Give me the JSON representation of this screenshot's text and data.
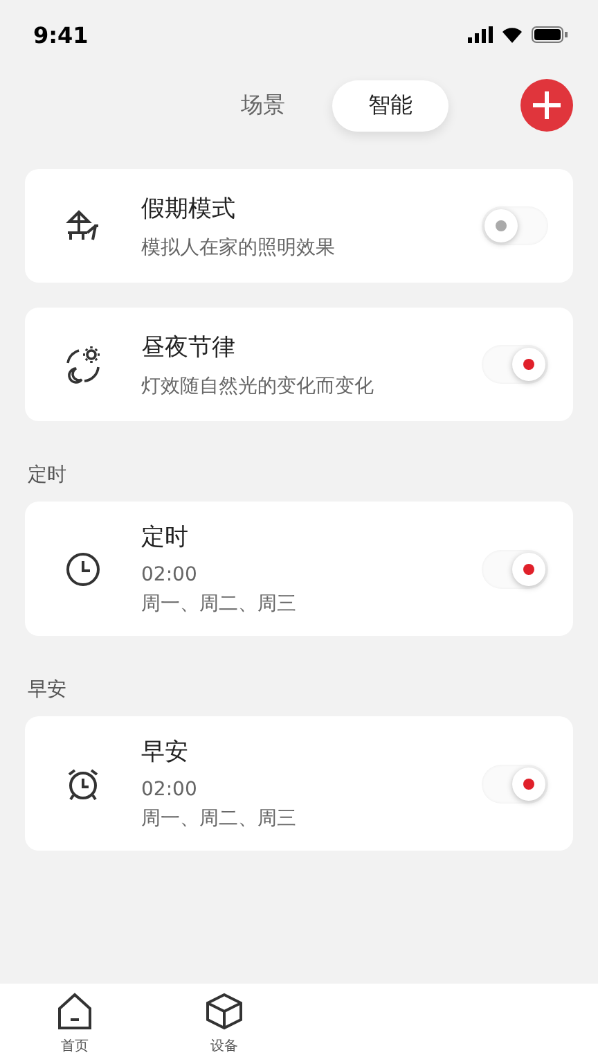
{
  "status_bar": {
    "time": "9:41"
  },
  "segments": [
    {
      "label": "场景",
      "selected": false
    },
    {
      "label": "智能",
      "selected": true
    }
  ],
  "sections": [
    {
      "cards": [
        {
          "kind": "umbrella",
          "title": "假期模式",
          "lines": [
            "模拟人在家的照明效果"
          ],
          "on": false
        },
        {
          "kind": "daynight",
          "title": "昼夜节律",
          "lines": [
            "灯效随自然光的变化而变化"
          ],
          "on": true
        }
      ]
    },
    {
      "heading": "定时",
      "cards": [
        {
          "kind": "clock",
          "title": "定时",
          "lines": [
            "02:00",
            "周一、周二、周三"
          ],
          "on": true
        }
      ]
    },
    {
      "heading": "早安",
      "cards": [
        {
          "kind": "alarm",
          "title": "早安",
          "lines": [
            "02:00",
            "周一、周二、周三"
          ],
          "on": true
        }
      ]
    }
  ],
  "tab_bar": [
    {
      "kind": "home",
      "label": "首页",
      "selected": false
    },
    {
      "kind": "box",
      "label": "设备",
      "selected": false
    }
  ]
}
